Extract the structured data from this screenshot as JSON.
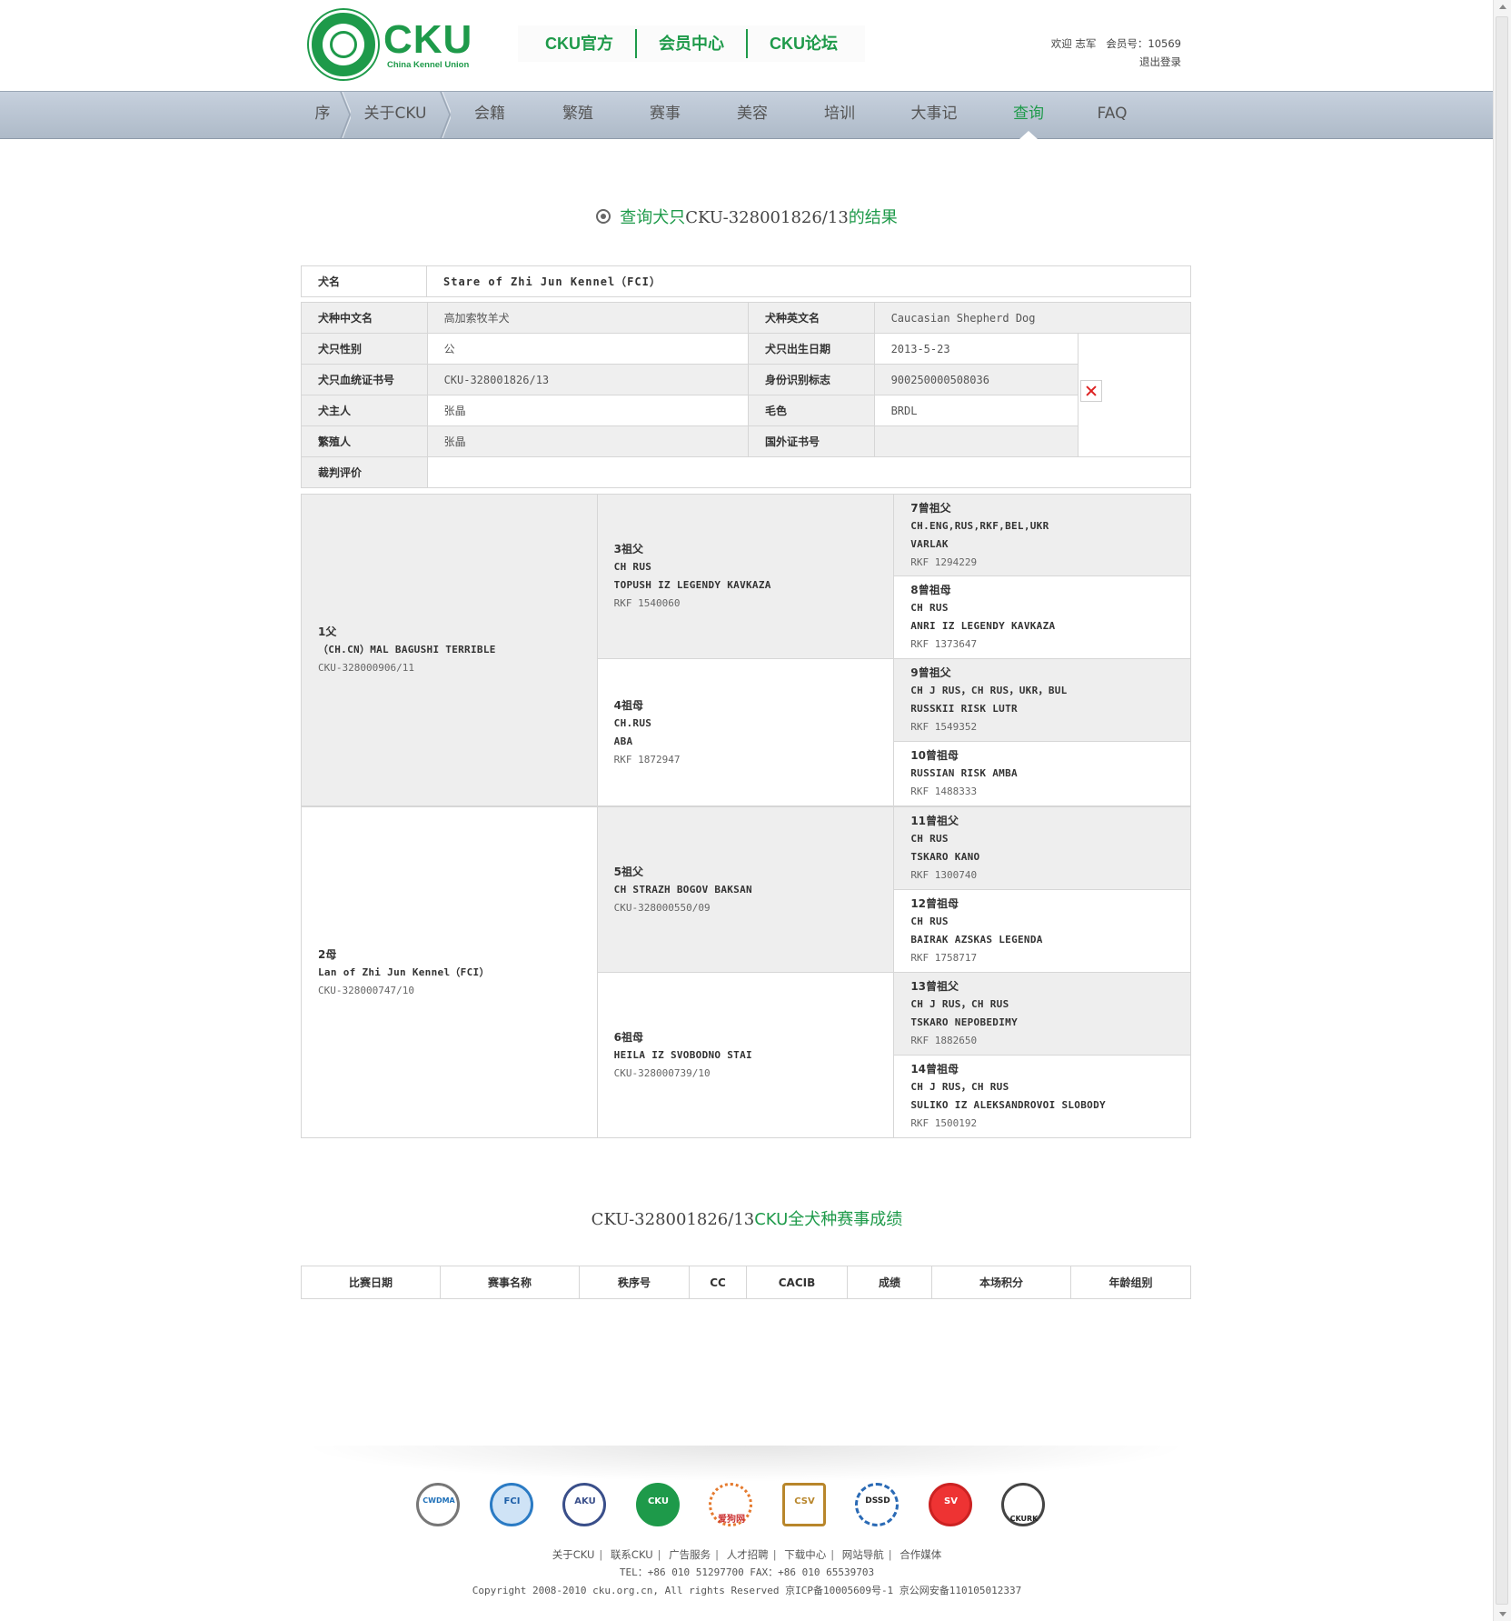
{
  "header": {
    "logo_text": "CKU",
    "logo_sub": "China Kennel Union",
    "top_links": [
      "CKU官方",
      "会员中心",
      "CKU论坛"
    ],
    "welcome": "欢迎 志军",
    "member_no": "会员号：10569",
    "logout": "退出登录"
  },
  "nav": {
    "items": [
      "序",
      "关于CKU",
      "会籍",
      "繁殖",
      "赛事",
      "美容",
      "培训",
      "大事记",
      "查询",
      "FAQ"
    ],
    "active_index": 8
  },
  "query": {
    "title_prefix": "查询犬只",
    "title_id": "CKU-328001826/13",
    "title_suffix": "的结果"
  },
  "dog": {
    "name_label": "犬名",
    "name": "Stare of Zhi Jun Kennel（FCI）",
    "breed_cn_label": "犬种中文名",
    "breed_cn": "高加索牧羊犬",
    "breed_en_label": "犬种英文名",
    "breed_en": "Caucasian Shepherd Dog",
    "sex_label": "犬只性别",
    "sex": "公",
    "dob_label": "犬只出生日期",
    "dob": "2013-5-23",
    "cert_label": "犬只血统证书号",
    "cert": "CKU-328001826/13",
    "chip_label": "身份识别标志",
    "chip": "900250000508036",
    "owner_label": "犬主人",
    "owner": "张晶",
    "color_label": "毛色",
    "color": "BRDL",
    "breeder_label": "繁殖人",
    "breeder": "张晶",
    "foreign_cert_label": "国外证书号",
    "foreign_cert": "",
    "judge_label": "裁判评价",
    "judge": ""
  },
  "pedigree": {
    "p1": {
      "title": "1父",
      "name": "（CH.CN）MAL BAGUSHI TERRIBLE",
      "reg": "CKU-328000906/11"
    },
    "p2": {
      "title": "2母",
      "name": "Lan of Zhi Jun Kennel（FCI）",
      "reg": "CKU-328000747/10"
    },
    "p3": {
      "title": "3祖父",
      "titles": "CH RUS",
      "name": "TOPUSH IZ LEGENDY KAVKAZA",
      "reg": "RKF 1540060"
    },
    "p4": {
      "title": "4祖母",
      "titles": "CH.RUS",
      "name": "ABA",
      "reg": "RKF 1872947"
    },
    "p5": {
      "title": "5祖父",
      "name": "CH STRAZH BOGOV BAKSAN",
      "reg": "CKU-328000550/09"
    },
    "p6": {
      "title": "6祖母",
      "name": "HEILA IZ SVOBODNO STAI",
      "reg": "CKU-328000739/10"
    },
    "p7": {
      "title": "7曾祖父",
      "titles": "CH.ENG,RUS,RKF,BEL,UKR",
      "name": "VARLAK",
      "reg": "RKF 1294229"
    },
    "p8": {
      "title": "8曾祖母",
      "titles": "CH RUS",
      "name": "ANRI IZ LEGENDY KAVKAZA",
      "reg": "RKF 1373647"
    },
    "p9": {
      "title": "9曾祖父",
      "titles": "CH J RUS，CH RUS，UKR，BUL",
      "name": "RUSSKII RISK LUTR",
      "reg": "RKF 1549352"
    },
    "p10": {
      "title": "10曾祖母",
      "name": "RUSSIAN RISK AMBA",
      "reg": "RKF 1488333"
    },
    "p11": {
      "title": "11曾祖父",
      "titles": "CH RUS",
      "name": "TSKARO KANO",
      "reg": "RKF 1300740"
    },
    "p12": {
      "title": "12曾祖母",
      "titles": "CH RUS",
      "name": "BAIRAK AZSKAS LEGENDA",
      "reg": "RKF 1758717"
    },
    "p13": {
      "title": "13曾祖父",
      "titles": "CH J RUS，CH RUS",
      "name": "TSKARO NEPOBEDIMY",
      "reg": "RKF 1882650"
    },
    "p14": {
      "title": "14曾祖母",
      "titles": "CH J RUS，CH RUS",
      "name": "SULIKO IZ ALEKSANDROVOI SLOBODY",
      "reg": "RKF 1500192"
    }
  },
  "results": {
    "title_id": "CKU-328001826/13",
    "title_suffix": "CKU全犬种赛事成绩",
    "columns": [
      "比赛日期",
      "赛事名称",
      "秩序号",
      "CC",
      "CACIB",
      "成绩",
      "本场积分",
      "年龄组别"
    ]
  },
  "footer": {
    "partners": [
      "CWDMA",
      "FCI",
      "AKU",
      "CKU",
      "爱狗网",
      "CSV",
      "DSSD",
      "SV",
      "CKURK"
    ],
    "links": [
      "关于CKU",
      "联系CKU",
      "广告服务",
      "人才招聘",
      "下载中心",
      "网站导航",
      "合作媒体"
    ],
    "contact": "TEL：+86 010 51297700  FAX：+86 010 65539703",
    "copyright": "Copyright 2008-2010 cku.org.cn, All rights Reserved  京ICP备10005609号-1  京公网安备110105012337"
  },
  "colors": {
    "brand": "#1e9a4a",
    "nav": "#b9c4d2"
  }
}
